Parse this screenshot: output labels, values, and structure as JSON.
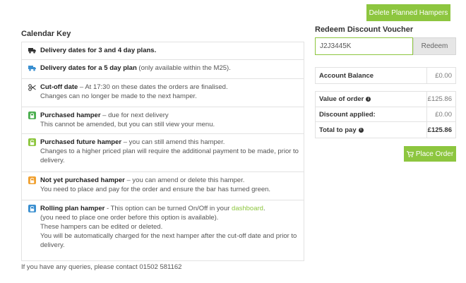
{
  "top_button": "Delete Planned Hampers",
  "calendar_key": {
    "title": "Calendar Key",
    "rows": [
      {
        "icon": "truck-icon",
        "bold": "Delivery dates for 3 and 4 day plans.",
        "rest": "",
        "lines": []
      },
      {
        "icon": "truck-blue-icon",
        "bold": "Delivery dates for a 5 day plan",
        "rest": " (only available within the M25).",
        "lines": []
      },
      {
        "icon": "scissors-icon",
        "bold": "Cut-off date",
        "rest": " – At 17:30 on these dates the orders are finalised.",
        "lines": [
          "Changes can no longer be made to the next hamper."
        ]
      },
      {
        "icon": "lock-green-icon",
        "bold": "Purchased hamper",
        "rest": " – due for next delivery",
        "lines": [
          "This cannot be amended, but you can still view your menu."
        ]
      },
      {
        "icon": "unlock-green-icon",
        "bold": "Purchased future hamper",
        "rest": " – you can still amend this hamper.",
        "lines": [
          "Changes to a higher priced plan will require the additional payment to be made, prior to delivery."
        ]
      },
      {
        "icon": "unlock-orange-icon",
        "bold": "Not yet purchased hamper",
        "rest": " – you can amend or delete this hamper.",
        "lines": [
          "You need to place and pay for the order and ensure the bar has turned green."
        ]
      },
      {
        "icon": "unlock-blue-icon",
        "bold": "Rolling plan hamper",
        "rest": " - This option can be turned On/Off in your ",
        "link": "dashboard",
        "rest2": ".",
        "lines": [
          "(you need to place one order before this option is available).",
          "These hampers can be edited or deleted.",
          "You will be automatically charged for the next hamper after the cut-off date and prior to delivery."
        ]
      }
    ],
    "footer": "If you have any queries, please contact 01502 581162"
  },
  "voucher": {
    "title": "Redeem Discount Voucher",
    "value": "J2J3445K",
    "button": "Redeem"
  },
  "balance": {
    "label": "Account Balance",
    "value": "£0.00"
  },
  "order": {
    "value_label": "Value of order",
    "value": "£125.86",
    "discount_label": "Discount applied:",
    "discount": "£0.00",
    "total_label": "Total to pay",
    "total": "£125.86"
  },
  "place_order": "Place Order",
  "colors": {
    "green": "#8dc63f",
    "orange": "#f0a030",
    "blue": "#3a8fd0"
  }
}
